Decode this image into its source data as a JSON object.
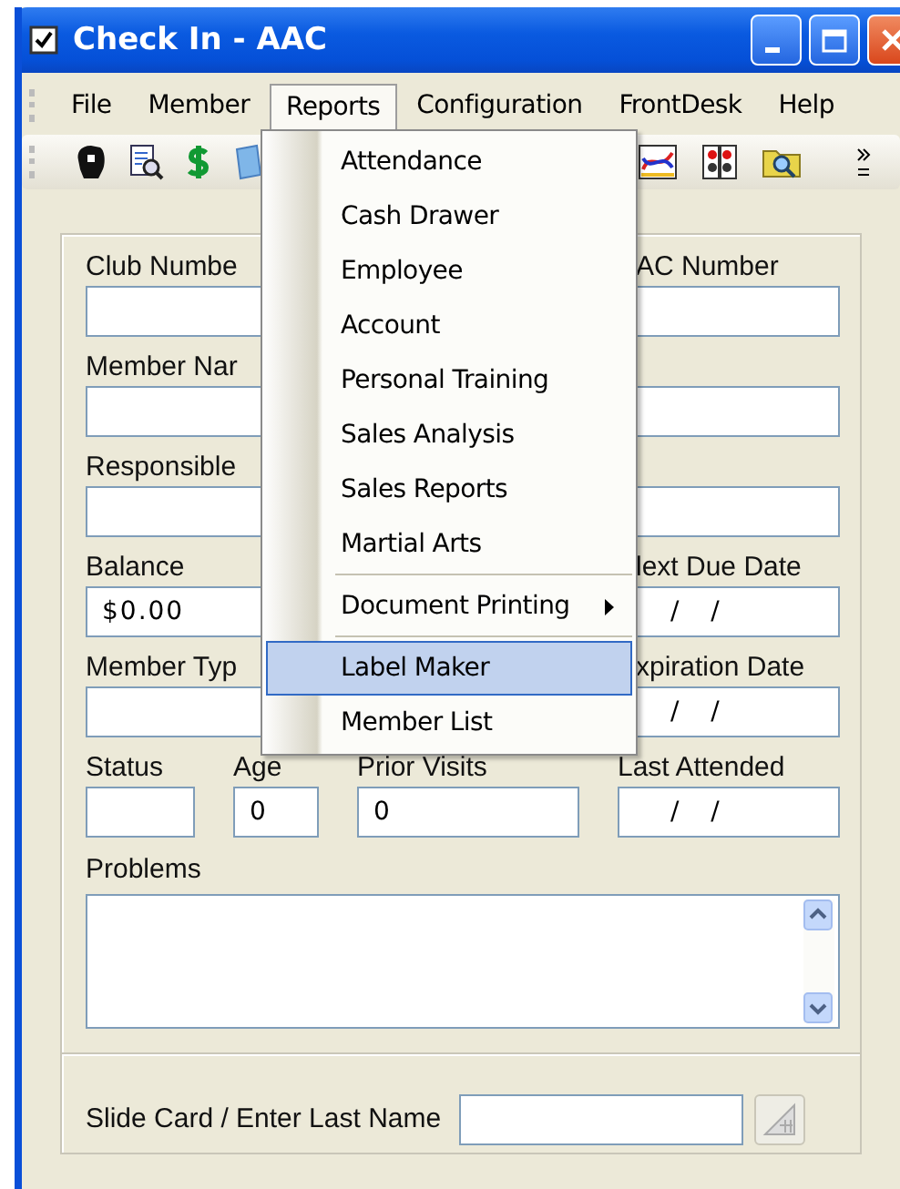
{
  "window": {
    "title": "Check In - AAC"
  },
  "menubar": [
    {
      "label": "File",
      "open": false
    },
    {
      "label": "Member",
      "open": false
    },
    {
      "label": "Reports",
      "open": true
    },
    {
      "label": "Configuration",
      "open": false
    },
    {
      "label": "FrontDesk",
      "open": false
    },
    {
      "label": "Help",
      "open": false
    }
  ],
  "reports_menu": [
    {
      "kind": "item",
      "label": "Attendance",
      "selected": false
    },
    {
      "kind": "item",
      "label": "Cash Drawer",
      "selected": false
    },
    {
      "kind": "item",
      "label": "Employee",
      "selected": false
    },
    {
      "kind": "item",
      "label": "Account",
      "selected": false
    },
    {
      "kind": "item",
      "label": "Personal Training",
      "selected": false
    },
    {
      "kind": "item",
      "label": "Sales Analysis",
      "selected": false
    },
    {
      "kind": "item",
      "label": "Sales Reports",
      "selected": false
    },
    {
      "kind": "item",
      "label": "Martial Arts",
      "selected": false
    },
    {
      "kind": "separator"
    },
    {
      "kind": "submenu",
      "label": "Document Printing",
      "selected": false
    },
    {
      "kind": "separator"
    },
    {
      "kind": "item",
      "label": "Label Maker",
      "selected": true
    },
    {
      "kind": "item",
      "label": "Member List",
      "selected": false
    }
  ],
  "form": {
    "rows": [
      [
        {
          "label": "Club Numbe",
          "kind": "text"
        },
        {
          "label": "AC Number",
          "kind": "text"
        }
      ],
      [
        {
          "label": "Member Nar",
          "kind": "text"
        }
      ],
      [
        {
          "label": "Responsible",
          "kind": "text"
        }
      ],
      [
        {
          "label": "Balance",
          "kind": "text",
          "value": "$0.00"
        },
        {
          "label": "lext Due Date",
          "kind": "date",
          "value": "/   /"
        }
      ],
      [
        {
          "label": "Member Typ",
          "kind": "text"
        },
        {
          "label": "xpiration Date",
          "kind": "date",
          "value": "/   /"
        }
      ],
      [
        {
          "label": "Status",
          "kind": "text"
        },
        {
          "label": "Age",
          "kind": "text",
          "value": "0"
        },
        {
          "label": "Prior Visits",
          "kind": "text",
          "value": "0"
        },
        {
          "label": "Last Attended",
          "kind": "date",
          "value": "/   /"
        }
      ]
    ],
    "problems": {
      "label": "Problems"
    },
    "slide_card": {
      "label": "Slide Card / Enter Last Name"
    }
  }
}
